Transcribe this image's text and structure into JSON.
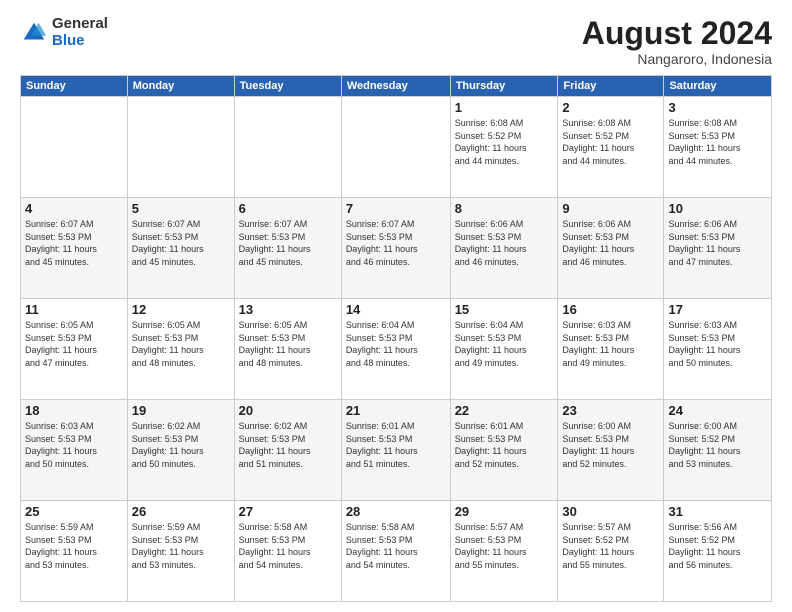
{
  "logo": {
    "general": "General",
    "blue": "Blue"
  },
  "header": {
    "month": "August 2024",
    "location": "Nangaroro, Indonesia"
  },
  "days_of_week": [
    "Sunday",
    "Monday",
    "Tuesday",
    "Wednesday",
    "Thursday",
    "Friday",
    "Saturday"
  ],
  "weeks": [
    [
      {
        "day": "",
        "info": ""
      },
      {
        "day": "",
        "info": ""
      },
      {
        "day": "",
        "info": ""
      },
      {
        "day": "",
        "info": ""
      },
      {
        "day": "1",
        "info": "Sunrise: 6:08 AM\nSunset: 5:52 PM\nDaylight: 11 hours\nand 44 minutes."
      },
      {
        "day": "2",
        "info": "Sunrise: 6:08 AM\nSunset: 5:52 PM\nDaylight: 11 hours\nand 44 minutes."
      },
      {
        "day": "3",
        "info": "Sunrise: 6:08 AM\nSunset: 5:53 PM\nDaylight: 11 hours\nand 44 minutes."
      }
    ],
    [
      {
        "day": "4",
        "info": "Sunrise: 6:07 AM\nSunset: 5:53 PM\nDaylight: 11 hours\nand 45 minutes."
      },
      {
        "day": "5",
        "info": "Sunrise: 6:07 AM\nSunset: 5:53 PM\nDaylight: 11 hours\nand 45 minutes."
      },
      {
        "day": "6",
        "info": "Sunrise: 6:07 AM\nSunset: 5:53 PM\nDaylight: 11 hours\nand 45 minutes."
      },
      {
        "day": "7",
        "info": "Sunrise: 6:07 AM\nSunset: 5:53 PM\nDaylight: 11 hours\nand 46 minutes."
      },
      {
        "day": "8",
        "info": "Sunrise: 6:06 AM\nSunset: 5:53 PM\nDaylight: 11 hours\nand 46 minutes."
      },
      {
        "day": "9",
        "info": "Sunrise: 6:06 AM\nSunset: 5:53 PM\nDaylight: 11 hours\nand 46 minutes."
      },
      {
        "day": "10",
        "info": "Sunrise: 6:06 AM\nSunset: 5:53 PM\nDaylight: 11 hours\nand 47 minutes."
      }
    ],
    [
      {
        "day": "11",
        "info": "Sunrise: 6:05 AM\nSunset: 5:53 PM\nDaylight: 11 hours\nand 47 minutes."
      },
      {
        "day": "12",
        "info": "Sunrise: 6:05 AM\nSunset: 5:53 PM\nDaylight: 11 hours\nand 48 minutes."
      },
      {
        "day": "13",
        "info": "Sunrise: 6:05 AM\nSunset: 5:53 PM\nDaylight: 11 hours\nand 48 minutes."
      },
      {
        "day": "14",
        "info": "Sunrise: 6:04 AM\nSunset: 5:53 PM\nDaylight: 11 hours\nand 48 minutes."
      },
      {
        "day": "15",
        "info": "Sunrise: 6:04 AM\nSunset: 5:53 PM\nDaylight: 11 hours\nand 49 minutes."
      },
      {
        "day": "16",
        "info": "Sunrise: 6:03 AM\nSunset: 5:53 PM\nDaylight: 11 hours\nand 49 minutes."
      },
      {
        "day": "17",
        "info": "Sunrise: 6:03 AM\nSunset: 5:53 PM\nDaylight: 11 hours\nand 50 minutes."
      }
    ],
    [
      {
        "day": "18",
        "info": "Sunrise: 6:03 AM\nSunset: 5:53 PM\nDaylight: 11 hours\nand 50 minutes."
      },
      {
        "day": "19",
        "info": "Sunrise: 6:02 AM\nSunset: 5:53 PM\nDaylight: 11 hours\nand 50 minutes."
      },
      {
        "day": "20",
        "info": "Sunrise: 6:02 AM\nSunset: 5:53 PM\nDaylight: 11 hours\nand 51 minutes."
      },
      {
        "day": "21",
        "info": "Sunrise: 6:01 AM\nSunset: 5:53 PM\nDaylight: 11 hours\nand 51 minutes."
      },
      {
        "day": "22",
        "info": "Sunrise: 6:01 AM\nSunset: 5:53 PM\nDaylight: 11 hours\nand 52 minutes."
      },
      {
        "day": "23",
        "info": "Sunrise: 6:00 AM\nSunset: 5:53 PM\nDaylight: 11 hours\nand 52 minutes."
      },
      {
        "day": "24",
        "info": "Sunrise: 6:00 AM\nSunset: 5:52 PM\nDaylight: 11 hours\nand 53 minutes."
      }
    ],
    [
      {
        "day": "25",
        "info": "Sunrise: 5:59 AM\nSunset: 5:53 PM\nDaylight: 11 hours\nand 53 minutes."
      },
      {
        "day": "26",
        "info": "Sunrise: 5:59 AM\nSunset: 5:53 PM\nDaylight: 11 hours\nand 53 minutes."
      },
      {
        "day": "27",
        "info": "Sunrise: 5:58 AM\nSunset: 5:53 PM\nDaylight: 11 hours\nand 54 minutes."
      },
      {
        "day": "28",
        "info": "Sunrise: 5:58 AM\nSunset: 5:53 PM\nDaylight: 11 hours\nand 54 minutes."
      },
      {
        "day": "29",
        "info": "Sunrise: 5:57 AM\nSunset: 5:53 PM\nDaylight: 11 hours\nand 55 minutes."
      },
      {
        "day": "30",
        "info": "Sunrise: 5:57 AM\nSunset: 5:52 PM\nDaylight: 11 hours\nand 55 minutes."
      },
      {
        "day": "31",
        "info": "Sunrise: 5:56 AM\nSunset: 5:52 PM\nDaylight: 11 hours\nand 56 minutes."
      }
    ]
  ]
}
